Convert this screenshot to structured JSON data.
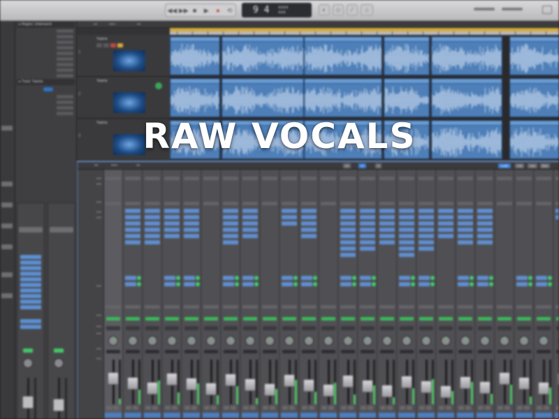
{
  "overlay": {
    "title": "RAW VOCALS"
  },
  "control_bar": {
    "lcd_value": "9 4",
    "buttons": [
      "transport-rewind",
      "transport-forward",
      "transport-stop",
      "transport-play",
      "transport-record",
      "transport-cycle"
    ]
  },
  "inspector": {
    "region_header": "▸ Region: Unbenannt",
    "track_header": "▸ Track: Yaama"
  },
  "tracks": {
    "headers": [
      {
        "name": "Yaama",
        "number": "1"
      },
      {
        "name": "Yaama",
        "number": "2"
      },
      {
        "name": "Yaama",
        "number": "3"
      }
    ]
  },
  "mixer": {
    "toolbar": {
      "tabs": [
        "Audio",
        "Inst",
        "Aux",
        "Bus",
        "Input",
        "Output",
        "Master/VCA",
        "MIDI"
      ]
    },
    "row_labels": [
      "Setting",
      "Gain Reduction",
      "EQ",
      "Input",
      "Audio FX",
      "Sends",
      "Output",
      "Group",
      "Automation",
      "Pan",
      "dB"
    ],
    "strip_count": 24
  },
  "colors": {
    "region_blue": "#4e7fb8",
    "plugin_blue": "#5f8ed0",
    "send_green": "#3ccf6a",
    "record_red": "#d43b2f",
    "cycle_yellow": "#d4aa3a"
  }
}
